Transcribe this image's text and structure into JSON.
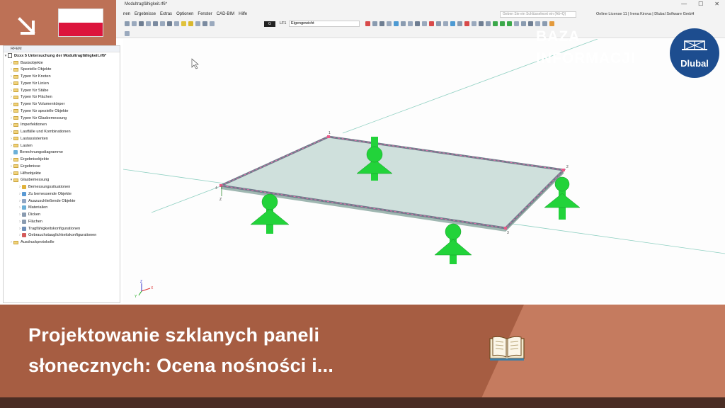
{
  "window": {
    "title": "Modultragfähigkeit.rf6*",
    "menus": [
      "nen",
      "Ergebnisse",
      "Extras",
      "Optionen",
      "Fenster",
      "CAD-BIM",
      "Hilfe"
    ],
    "search_placeholder": "Geben Sie ein Schlüsselwort ein (Alt+Q)",
    "license": "Online License 11 | Irena Kirova | Dlubal Software GmbH",
    "controls": [
      "—",
      "☐",
      "✕"
    ]
  },
  "toolbar": {
    "load_case_badge": "G",
    "load_case_id": "LF1",
    "load_case_name": "Eigengewicht"
  },
  "navigator": {
    "header": "RFEM",
    "root": "Dxxx 5 Untersuchung der Modultragfähigkeit.rf6*",
    "items": [
      {
        "label": "Basisobjekte",
        "level": 1,
        "type": "folder"
      },
      {
        "label": "Spezielle Objekte",
        "level": 1,
        "type": "folder"
      },
      {
        "label": "Typen für Knoten",
        "level": 1,
        "type": "folder"
      },
      {
        "label": "Typen für Linien",
        "level": 1,
        "type": "folder"
      },
      {
        "label": "Typen für Stäbe",
        "level": 1,
        "type": "folder"
      },
      {
        "label": "Typen für Flächen",
        "level": 1,
        "type": "folder"
      },
      {
        "label": "Typen für Volumenkörper",
        "level": 1,
        "type": "folder"
      },
      {
        "label": "Typen für spezielle Objekte",
        "level": 1,
        "type": "folder"
      },
      {
        "label": "Typen für Glasbemessung",
        "level": 1,
        "type": "folder"
      },
      {
        "label": "Imperfektionen",
        "level": 1,
        "type": "folder"
      },
      {
        "label": "Lastfälle und Kombinationen",
        "level": 1,
        "type": "folder"
      },
      {
        "label": "Lastassistenten",
        "level": 1,
        "type": "folder"
      },
      {
        "label": "Lasten",
        "level": 1,
        "type": "folder"
      },
      {
        "label": "Berechnungsdiagramme",
        "level": 1,
        "type": "leaf"
      },
      {
        "label": "Ergebnisobjekte",
        "level": 1,
        "type": "folder"
      },
      {
        "label": "Ergebnisse",
        "level": 1,
        "type": "folder"
      },
      {
        "label": "Hilfsobjekte",
        "level": 1,
        "type": "folder"
      },
      {
        "label": "Glasbemessung",
        "level": 1,
        "type": "folder-open"
      },
      {
        "label": "Bemessungssituationen",
        "level": 2,
        "type": "leaf"
      },
      {
        "label": "Zu bemessende Objekte",
        "level": 2,
        "type": "leaf"
      },
      {
        "label": "Auszuschließende Objekte",
        "level": 2,
        "type": "leaf"
      },
      {
        "label": "Materialien",
        "level": 2,
        "type": "leaf"
      },
      {
        "label": "Dicken",
        "level": 2,
        "type": "leaf"
      },
      {
        "label": "Flächen",
        "level": 2,
        "type": "leaf"
      },
      {
        "label": "Tragfähigkeitskonfigurationen",
        "level": 2,
        "type": "leaf"
      },
      {
        "label": "Gebrauchstauglichkeitskonfigurationen",
        "level": 2,
        "type": "leaf"
      },
      {
        "label": "Ausdruckprotokolle",
        "level": 1,
        "type": "folder"
      }
    ]
  },
  "viewport": {
    "axis_labels": {
      "x": "X",
      "y": "Y",
      "z": "Z"
    },
    "node_labels": [
      "1",
      "2",
      "3",
      "4"
    ]
  },
  "logo": {
    "text": "Dlubal"
  },
  "banner": {
    "title_line1": "Projektowanie szklanych paneli",
    "title_line2": "słonecznych: Ocena nośności i...",
    "kb_line1": "BAZA",
    "kb_line2": "INFORMACJI"
  },
  "colors": {
    "banner": "#a65d42",
    "banner_accent": "#c57b5f",
    "support_green": "#22d33a",
    "plate_fill": "#cfe0dc",
    "logo_blue": "#1d4d8f"
  }
}
